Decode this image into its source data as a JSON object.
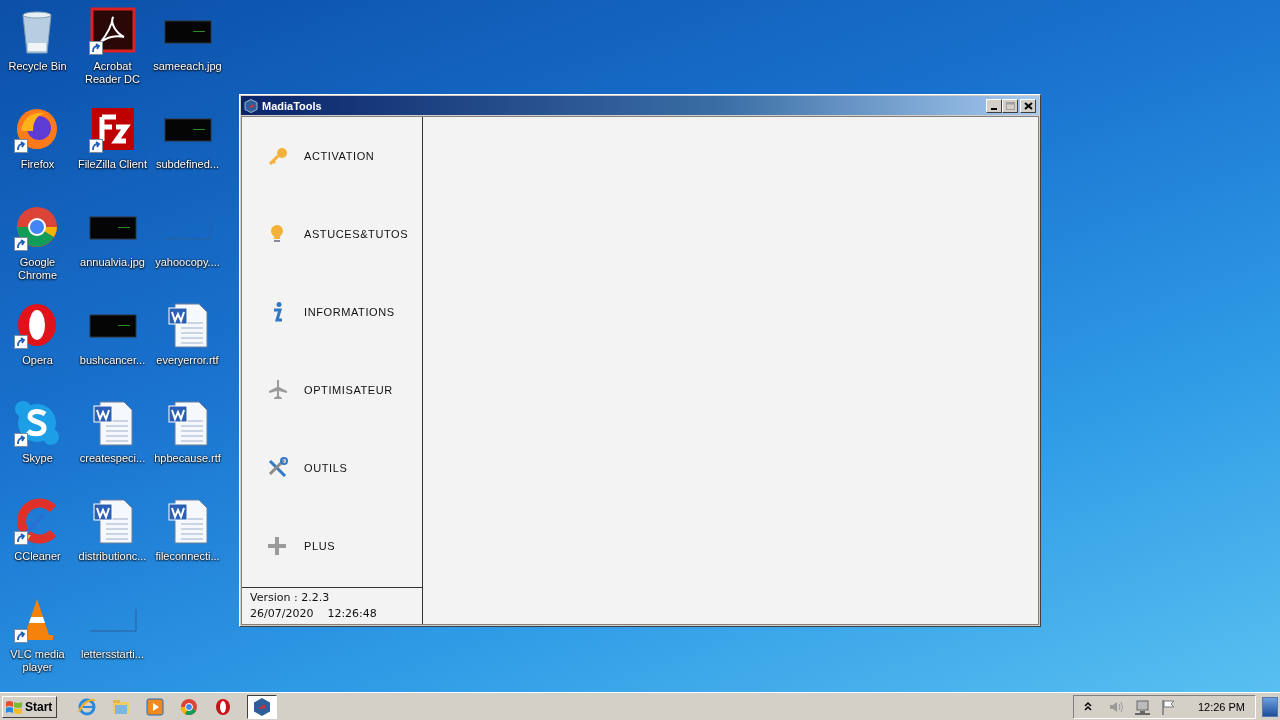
{
  "desktop": {
    "icons": [
      {
        "label": "Recycle Bin",
        "kind": "recycle",
        "shortcut": false
      },
      {
        "label": "Firefox",
        "kind": "firefox",
        "shortcut": true
      },
      {
        "label": "Google Chrome",
        "kind": "chrome",
        "shortcut": true
      },
      {
        "label": "Opera",
        "kind": "opera",
        "shortcut": true
      },
      {
        "label": "Skype",
        "kind": "skype",
        "shortcut": true
      },
      {
        "label": "CCleaner",
        "kind": "ccleaner",
        "shortcut": true
      },
      {
        "label": "VLC media player",
        "kind": "vlc",
        "shortcut": true
      },
      {
        "label": "Acrobat Reader DC",
        "kind": "acrobat",
        "shortcut": true
      },
      {
        "label": "FileZilla Client",
        "kind": "filezilla",
        "shortcut": true
      },
      {
        "label": "annualvia.jpg",
        "kind": "image",
        "shortcut": false
      },
      {
        "label": "bushcancer...",
        "kind": "image",
        "shortcut": false
      },
      {
        "label": "createspeci...",
        "kind": "word",
        "shortcut": false
      },
      {
        "label": "distributionc...",
        "kind": "word",
        "shortcut": false
      },
      {
        "label": "lettersstarti...",
        "kind": "blank",
        "shortcut": false
      },
      {
        "label": "sameeach.jpg",
        "kind": "image",
        "shortcut": false
      },
      {
        "label": "subdefined...",
        "kind": "image",
        "shortcut": false
      },
      {
        "label": "yahoocopy....",
        "kind": "blank",
        "shortcut": false
      },
      {
        "label": "everyerror.rtf",
        "kind": "word",
        "shortcut": false
      },
      {
        "label": "hpbecause.rtf",
        "kind": "word",
        "shortcut": false
      },
      {
        "label": "fileconnecti...",
        "kind": "word",
        "shortcut": false
      }
    ]
  },
  "window": {
    "title": "MadiaTools",
    "buttons": [
      {
        "kind": "minimize",
        "disabled": false
      },
      {
        "kind": "maximize",
        "disabled": true
      },
      {
        "kind": "close",
        "disabled": false
      }
    ],
    "menu": [
      {
        "label": "ACTIVATION",
        "kind": "key"
      },
      {
        "label": "ASTUCES&TUTOS",
        "kind": "bulb"
      },
      {
        "label": "INFORMATIONS",
        "kind": "info"
      },
      {
        "label": "OPTIMISATEUR",
        "kind": "plane"
      },
      {
        "label": "OUTILS",
        "kind": "tools"
      },
      {
        "label": "PLUS",
        "kind": "plus"
      }
    ],
    "version": "Version : 2.2.3",
    "date": "26/07/2020",
    "time": "12:26:48"
  },
  "taskbar": {
    "start": "Start",
    "apps": [
      {
        "kind": "ie",
        "active": false
      },
      {
        "kind": "explorer",
        "active": false
      },
      {
        "kind": "media",
        "active": false
      },
      {
        "kind": "chrome",
        "active": false
      },
      {
        "kind": "opera",
        "active": false
      },
      {
        "kind": "madiatools",
        "active": true
      }
    ],
    "tray": [
      {
        "kind": "chevron"
      },
      {
        "kind": "volume"
      },
      {
        "kind": "network"
      },
      {
        "kind": "flag"
      }
    ],
    "clock": "12:26 PM"
  }
}
